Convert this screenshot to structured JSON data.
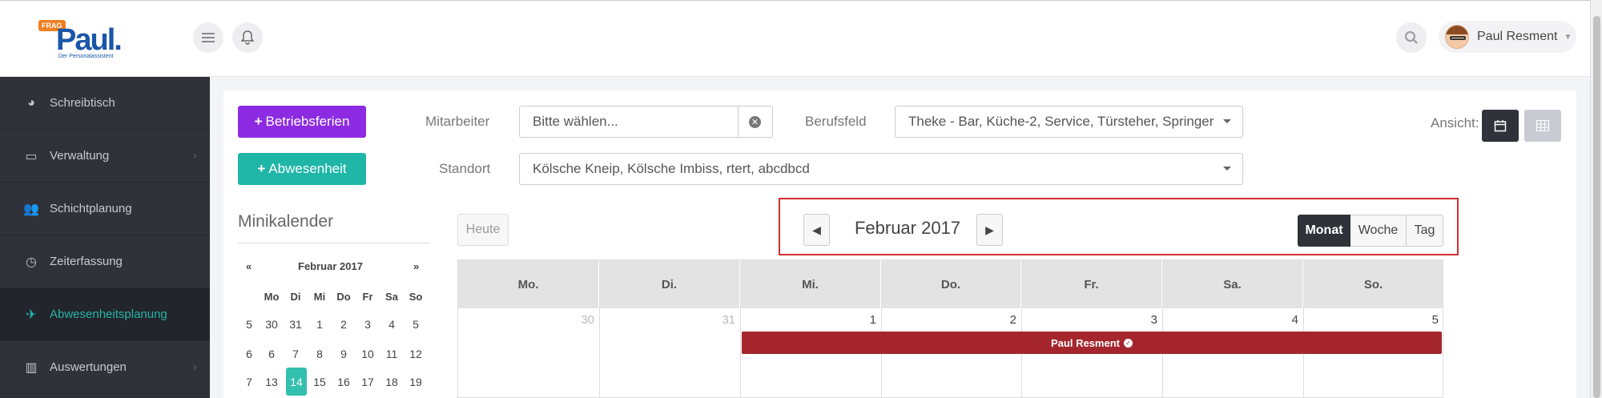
{
  "header": {
    "logo": {
      "badge": "FRAG",
      "name": "Paul.",
      "tagline": "Der Personalassistent"
    },
    "menu_icon": "hamburger-icon",
    "bell_icon": "bell-icon",
    "search_icon": "search-icon",
    "user": {
      "name": "Paul Resment"
    }
  },
  "sidebar": {
    "items": [
      {
        "label": "Schreibtisch",
        "icon": "dashboard-icon",
        "active": false,
        "has_chevron": false
      },
      {
        "label": "Verwaltung",
        "icon": "laptop-icon",
        "active": false,
        "has_chevron": true
      },
      {
        "label": "Schichtplanung",
        "icon": "users-icon",
        "active": false,
        "has_chevron": false
      },
      {
        "label": "Zeiterfassung",
        "icon": "clock-icon",
        "active": false,
        "has_chevron": false
      },
      {
        "label": "Abwesenheitsplanung",
        "icon": "plane-icon",
        "active": true,
        "has_chevron": false
      },
      {
        "label": "Auswertungen",
        "icon": "bar-chart-icon",
        "active": false,
        "has_chevron": true
      }
    ],
    "active_color": "#26b4a8"
  },
  "toolbar": {
    "betriebsferien_label": "Betriebsferien",
    "abwesenheit_label": "Abwesenheit",
    "mitarbeiter_label": "Mitarbeiter",
    "mitarbeiter_placeholder": "Bitte wählen...",
    "berufsfeld_label": "Berufsfeld",
    "berufsfeld_value": "Theke - Bar, Küche-2, Service, Türsteher, Springer",
    "standort_label": "Standort",
    "standort_value": "Kölsche Kneip, Kölsche Imbiss, rtert, abcdbcd",
    "ansicht_label": "Ansicht:"
  },
  "mini_calendar": {
    "title": "Minikalender",
    "prev": "«",
    "next": "»",
    "month_label": "Februar 2017",
    "weekday_headers": [
      "Mo",
      "Di",
      "Mi",
      "Do",
      "Fr",
      "Sa",
      "So"
    ],
    "rows": [
      {
        "week": "5",
        "days": [
          "30",
          "31",
          "1",
          "2",
          "3",
          "4",
          "5"
        ]
      },
      {
        "week": "6",
        "days": [
          "6",
          "7",
          "8",
          "9",
          "10",
          "11",
          "12"
        ]
      },
      {
        "week": "7",
        "days": [
          "13",
          "14",
          "15",
          "16",
          "17",
          "18",
          "19"
        ]
      }
    ],
    "today": "14"
  },
  "calendar": {
    "today_label": "Heute",
    "month_title": "Februar 2017",
    "views": [
      "Monat",
      "Woche",
      "Tag"
    ],
    "active_view": "Monat",
    "weekday_headers": [
      "Mo.",
      "Di.",
      "Mi.",
      "Do.",
      "Fr.",
      "Sa.",
      "So."
    ],
    "first_week": [
      "30",
      "31",
      "1",
      "2",
      "3",
      "4",
      "5"
    ],
    "event": {
      "label": "Paul Resment",
      "color": "#a4262c",
      "start_day": "1",
      "end_day": "5"
    }
  }
}
